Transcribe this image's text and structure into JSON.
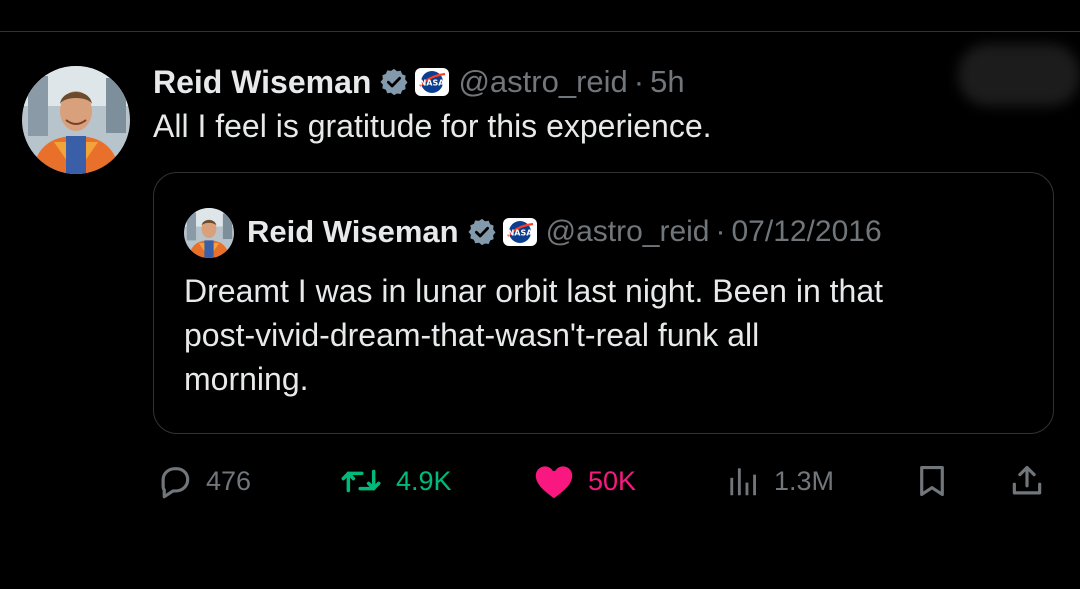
{
  "tweet": {
    "author_name": "Reid Wiseman",
    "handle": "@astro_reid",
    "separator": "·",
    "time": "5h",
    "text": "All I feel is gratitude for this experience."
  },
  "quoted_tweet": {
    "author_name": "Reid Wiseman",
    "handle": "@astro_reid",
    "separator": "·",
    "date": "07/12/2016",
    "text": "Dreamt I was in lunar orbit last night. Been in that\npost-vivid-dream-that-wasn't-real funk all\nmorning."
  },
  "actions": {
    "replies": "476",
    "reposts": "4.9K",
    "likes": "50K",
    "views": "1.3M"
  },
  "icons": {
    "verified": "verified-badge-icon",
    "affiliation": "nasa-logo-icon",
    "reply": "reply-bubble-icon",
    "repost": "repost-icon",
    "like": "heart-icon",
    "views": "views-bars-icon",
    "bookmark": "bookmark-icon",
    "share": "share-icon"
  },
  "colors": {
    "background": "#000000",
    "text_primary": "#e7e9ea",
    "text_secondary": "#71767b",
    "verified": "#829aab",
    "repost_active": "#00ba7c",
    "like_active": "#f91880",
    "border": "#2f3336"
  }
}
